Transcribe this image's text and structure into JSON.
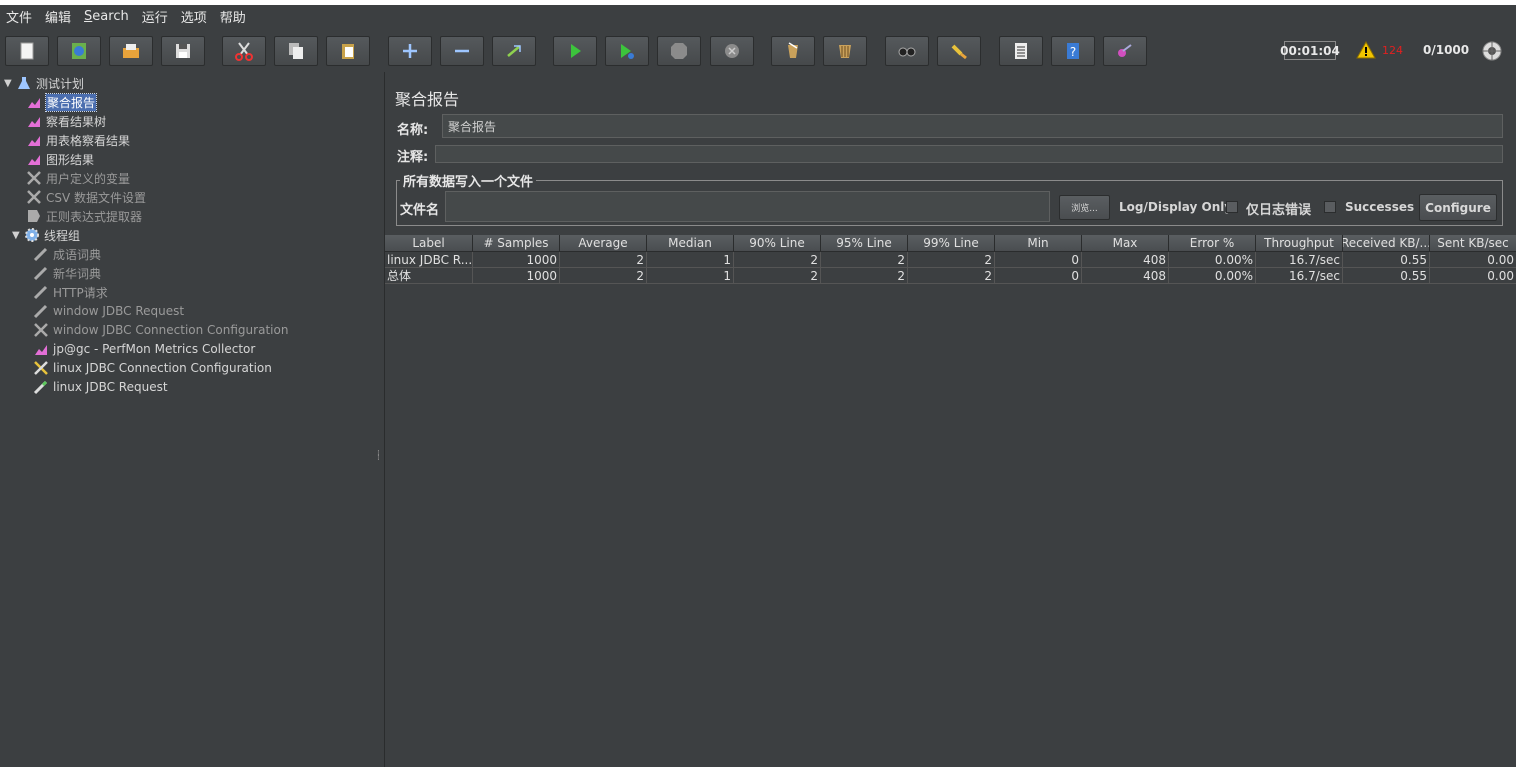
{
  "menu": [
    "文件",
    "编辑",
    "Search",
    "运行",
    "选项",
    "帮助"
  ],
  "toolbar": {
    "buttons": [
      "new-icon",
      "templates-icon",
      "open-icon",
      "save-icon",
      "cut-icon",
      "copy-icon",
      "paste-icon",
      "expand-icon",
      "collapse-icon",
      "toggle-icon",
      "start-icon",
      "start-no-pauses-icon",
      "stop-icon",
      "shutdown-icon",
      "clear-icon",
      "clear-all-icon",
      "search-icon",
      "reset-search-icon",
      "function-helper-icon",
      "help-icon",
      "remote-icon"
    ],
    "timer": "00:01:04",
    "warning_count": "124",
    "threads": "0/1000"
  },
  "tree": {
    "items": [
      {
        "label": "测试计划",
        "icon": "testplan-icon"
      },
      {
        "label": "聚合报告",
        "icon": "graph-icon"
      },
      {
        "label": "察看结果树",
        "icon": "graph-icon"
      },
      {
        "label": "用表格察看结果",
        "icon": "graph-icon"
      },
      {
        "label": "图形结果",
        "icon": "graph-icon"
      },
      {
        "label": "用户定义的变量",
        "icon": "config-icon"
      },
      {
        "label": "CSV 数据文件设置",
        "icon": "config-icon"
      },
      {
        "label": "正则表达式提取器",
        "icon": "extractor-icon"
      },
      {
        "label": "线程组",
        "icon": "threadgroup-icon"
      },
      {
        "label": "成语词典",
        "icon": "sampler-icon"
      },
      {
        "label": "新华词典",
        "icon": "sampler-icon"
      },
      {
        "label": "HTTP请求",
        "icon": "sampler-icon"
      },
      {
        "label": "window JDBC Request",
        "icon": "sampler-icon"
      },
      {
        "label": "window JDBC Connection Configuration",
        "icon": "config-icon"
      },
      {
        "label": "jp@gc - PerfMon Metrics Collector",
        "icon": "graph-icon"
      },
      {
        "label": "linux JDBC Connection Configuration",
        "icon": "config-icon"
      },
      {
        "label": "linux JDBC Request",
        "icon": "sampler-icon"
      }
    ]
  },
  "panel": {
    "title": "聚合报告",
    "name_label": "名称:",
    "name_value": "聚合报告",
    "comment_label": "注释:",
    "comment_value": "",
    "file_group_title": "所有数据写入一个文件",
    "filename_label": "文件名",
    "filename_value": "",
    "browse_label": "浏览...",
    "log_display_label": "Log/Display Only:",
    "errors_label": "仅日志错误",
    "successes_label": "Successes",
    "configure_label": "Configure"
  },
  "table": {
    "columns": [
      "Label",
      "# Samples",
      "Average",
      "Median",
      "90% Line",
      "95% Line",
      "99% Line",
      "Min",
      "Max",
      "Error %",
      "Throughput",
      "Received KB/...",
      "Sent KB/sec"
    ],
    "rows": [
      [
        "linux JDBC R...",
        "1000",
        "2",
        "1",
        "2",
        "2",
        "2",
        "0",
        "408",
        "0.00%",
        "16.7/sec",
        "0.55",
        "0.00"
      ],
      [
        "总体",
        "1000",
        "2",
        "1",
        "2",
        "2",
        "2",
        "0",
        "408",
        "0.00%",
        "16.7/sec",
        "0.55",
        "0.00"
      ]
    ]
  }
}
